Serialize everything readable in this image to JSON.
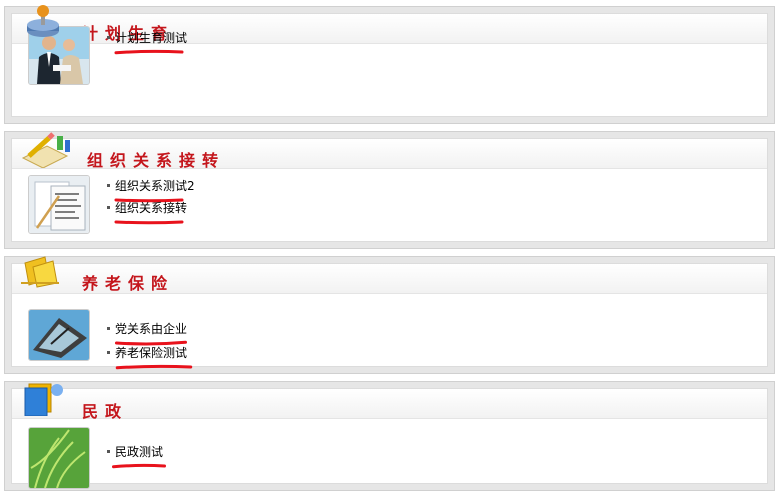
{
  "sections": [
    {
      "title": "计划生育",
      "icon": "joystick-icon",
      "image": "business-people-photo",
      "links": [
        {
          "label": "计划生育测试"
        }
      ]
    },
    {
      "title": "组织关系接转",
      "icon": "pencil-notebook-icon",
      "image": "documents-photo",
      "links": [
        {
          "label": "组织关系测试2"
        },
        {
          "label": "组织关系接转"
        }
      ]
    },
    {
      "title": "养老保险",
      "icon": "folders-icon",
      "image": "tablet-device-photo",
      "links": [
        {
          "label": "党关系由企业"
        },
        {
          "label": "养老保险测试"
        }
      ]
    },
    {
      "title": "民政",
      "icon": "blue-book-icon",
      "image": "wheat-field-photo",
      "links": [
        {
          "label": "民政测试"
        }
      ]
    }
  ],
  "colors": {
    "title": "#c4161c",
    "underline_mark": "#e8121c"
  }
}
